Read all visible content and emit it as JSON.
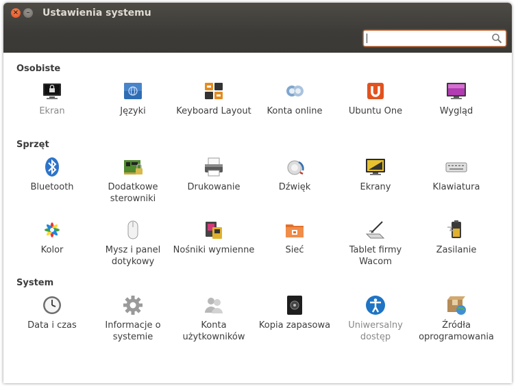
{
  "window": {
    "title": "Ustawienia systemu",
    "close_glyph": "×",
    "min_glyph": "–"
  },
  "search": {
    "placeholder": "",
    "value": ""
  },
  "sections": [
    {
      "title": "Osobiste",
      "items": [
        {
          "label": "Ekran",
          "icon": "display-lock-icon",
          "dim": true
        },
        {
          "label": "Języki",
          "icon": "language-flag-icon"
        },
        {
          "label": "Keyboard Layout",
          "icon": "keyboard-layout-icon"
        },
        {
          "label": "Konta online",
          "icon": "online-accounts-icon"
        },
        {
          "label": "Ubuntu One",
          "icon": "ubuntu-one-icon"
        },
        {
          "label": "Wygląd",
          "icon": "appearance-icon"
        }
      ]
    },
    {
      "title": "Sprzęt",
      "items": [
        {
          "label": "Bluetooth",
          "icon": "bluetooth-icon"
        },
        {
          "label": "Dodatkowe sterowniki",
          "icon": "drivers-chip-icon"
        },
        {
          "label": "Drukowanie",
          "icon": "printer-icon"
        },
        {
          "label": "Dźwięk",
          "icon": "sound-icon"
        },
        {
          "label": "Ekrany",
          "icon": "displays-icon"
        },
        {
          "label": "Klawiatura",
          "icon": "keyboard-icon"
        },
        {
          "label": "Kolor",
          "icon": "color-icon"
        },
        {
          "label": "Mysz i panel dotykowy",
          "icon": "mouse-icon"
        },
        {
          "label": "Nośniki wymienne",
          "icon": "removable-media-icon"
        },
        {
          "label": "Sieć",
          "icon": "network-folder-icon"
        },
        {
          "label": "Tablet firmy Wacom",
          "icon": "tablet-icon"
        },
        {
          "label": "Zasilanie",
          "icon": "battery-icon"
        }
      ]
    },
    {
      "title": "System",
      "items": [
        {
          "label": "Data i czas",
          "icon": "clock-icon"
        },
        {
          "label": "Informacje o systemie",
          "icon": "gear-icon"
        },
        {
          "label": "Konta użytkowników",
          "icon": "users-icon"
        },
        {
          "label": "Kopia zapasowa",
          "icon": "backup-safe-icon"
        },
        {
          "label": "Uniwersalny dostęp",
          "icon": "accessibility-icon",
          "dim": true
        },
        {
          "label": "Źródła oprogramowania",
          "icon": "software-sources-icon"
        }
      ]
    }
  ]
}
